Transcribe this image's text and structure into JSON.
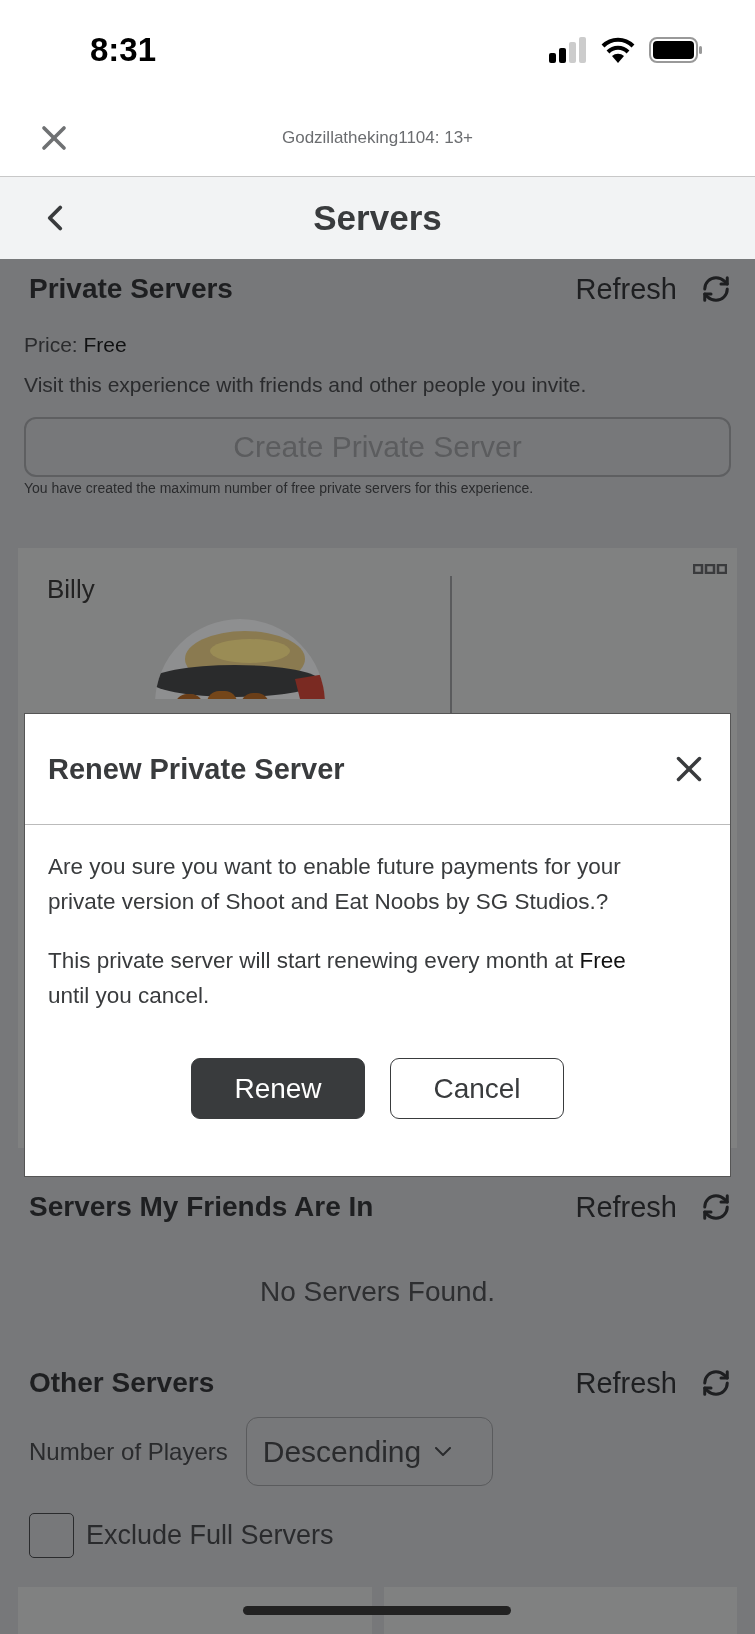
{
  "status_bar": {
    "time": "8:31"
  },
  "header": {
    "title": "Godzillatheking1104: 13+"
  },
  "nav": {
    "title": "Servers"
  },
  "private_servers": {
    "title": "Private Servers",
    "refresh": "Refresh",
    "price": "Price: **Free**",
    "description": "Visit this experience with friends and other people you invite.",
    "create_button": {
      "label": "Create Private Server",
      "disabled": true
    },
    "note": "You have created the maximum number of free private servers for this experience.",
    "servers": [
      {
        "name": "Billy"
      }
    ]
  },
  "dialog": {
    "title": "Renew Private Server",
    "message": "Are you sure you want to enable future payments for your private version of Shoot and Eat Noobs by SG Studios.?",
    "renewal": "This private server will start renewing every month at **Free** until you cancel.",
    "buttons": [
      {
        "label": "Renew",
        "kind": "primary"
      },
      {
        "label": "Cancel",
        "kind": "secondary"
      }
    ]
  },
  "friends_servers": {
    "title": "Servers My Friends Are In",
    "refresh": "Refresh",
    "empty": "No Servers Found."
  },
  "other_servers": {
    "title": "Other Servers",
    "refresh": "Refresh",
    "sort_label": "Number of Players",
    "sort_value": "Descending",
    "exclude_full": {
      "label": "Exclude Full Servers",
      "checked": false
    }
  }
}
